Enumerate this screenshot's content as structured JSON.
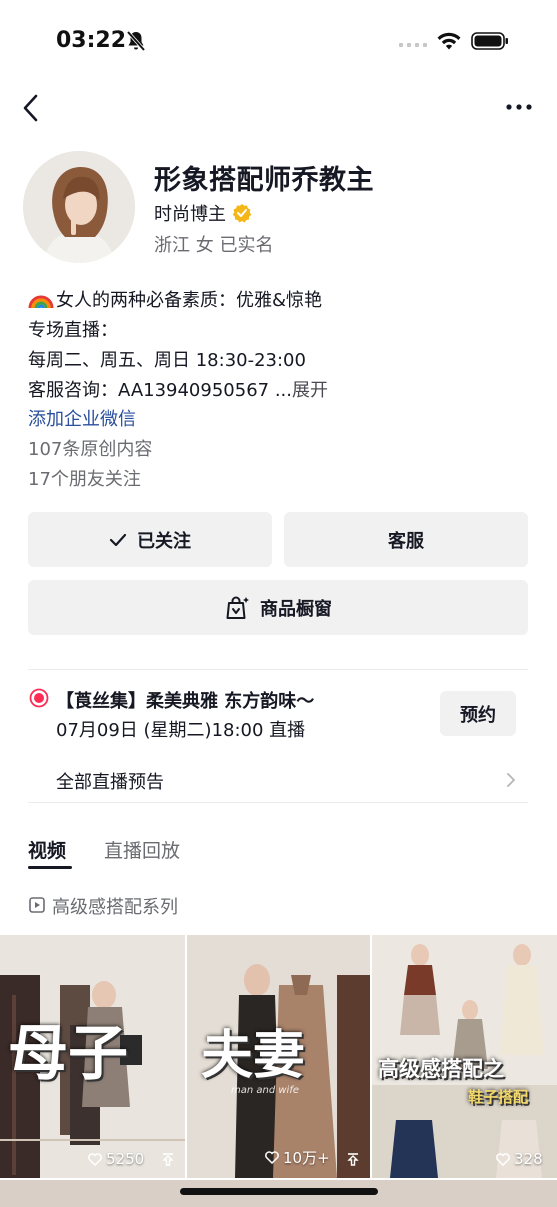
{
  "status_bar": {
    "time": "03:22"
  },
  "profile": {
    "name": "形象搭配师乔教主",
    "role": "时尚博主",
    "meta": "浙江  女  已实名"
  },
  "bio": {
    "line1": "女人的两种必备素质：优雅&惊艳",
    "line2": "专场直播：",
    "line3": "每周二、周五、周日 18:30-23:00",
    "line4": "客服咨询：AA13940950567 ...",
    "expand": "展开",
    "wechat_link": "添加企业微信",
    "original_count": "107条原创内容",
    "friends_follow": "17个朋友关注"
  },
  "buttons": {
    "follow": "已关注",
    "customer_service": "客服",
    "shop_window": "商品橱窗",
    "reserve": "预约"
  },
  "live": {
    "title": "【莨丝集】柔美典雅 东方韵味～",
    "time": "07月09日 (星期二)18:00 直播",
    "all_previews": "全部直播预告"
  },
  "tabs": [
    {
      "label": "视频",
      "active": true
    },
    {
      "label": "直播回放",
      "active": false
    }
  ],
  "series": "高级感搭配系列",
  "videos": [
    {
      "caption": "母子",
      "likes": "5250"
    },
    {
      "caption": "夫妻",
      "subtitle": "man and wife",
      "likes": "10万+"
    },
    {
      "caption": "高级感搭配之",
      "caption2": "鞋子搭配",
      "likes": "328"
    }
  ],
  "colors": {
    "link": "#2a4f9c",
    "live_red": "#fe2c55",
    "verified": "#f5b718"
  }
}
